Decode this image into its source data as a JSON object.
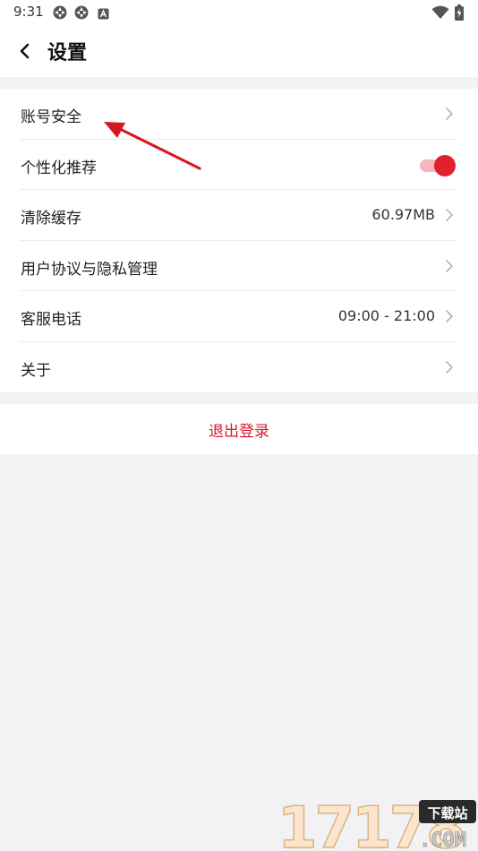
{
  "status_bar": {
    "time": "9:31"
  },
  "header": {
    "title": "设置"
  },
  "settings": {
    "items": [
      {
        "label": "账号安全",
        "value": ""
      },
      {
        "label": "个性化推荐",
        "toggle_on": true
      },
      {
        "label": "清除缓存",
        "value": "60.97MB"
      },
      {
        "label": "用户协议与隐私管理",
        "value": ""
      },
      {
        "label": "客服电话",
        "value": "09:00 - 21:00"
      },
      {
        "label": "关于",
        "value": ""
      }
    ]
  },
  "logout": {
    "label": "退出登录"
  },
  "watermark": {
    "number": "17178",
    "tag": "下载站",
    "domain": ".COM"
  },
  "colors": {
    "accent": "#e0202f",
    "logout_text": "#d9182b",
    "background": "#f2f2f4",
    "annotation": "#d6191e"
  },
  "icons": {
    "status": [
      "aperture-icon",
      "aperture-icon",
      "a-square-icon",
      "wifi-icon",
      "battery-charging-icon"
    ],
    "back": "chevron-left-icon",
    "row_arrow": "chevron-right-icon"
  }
}
